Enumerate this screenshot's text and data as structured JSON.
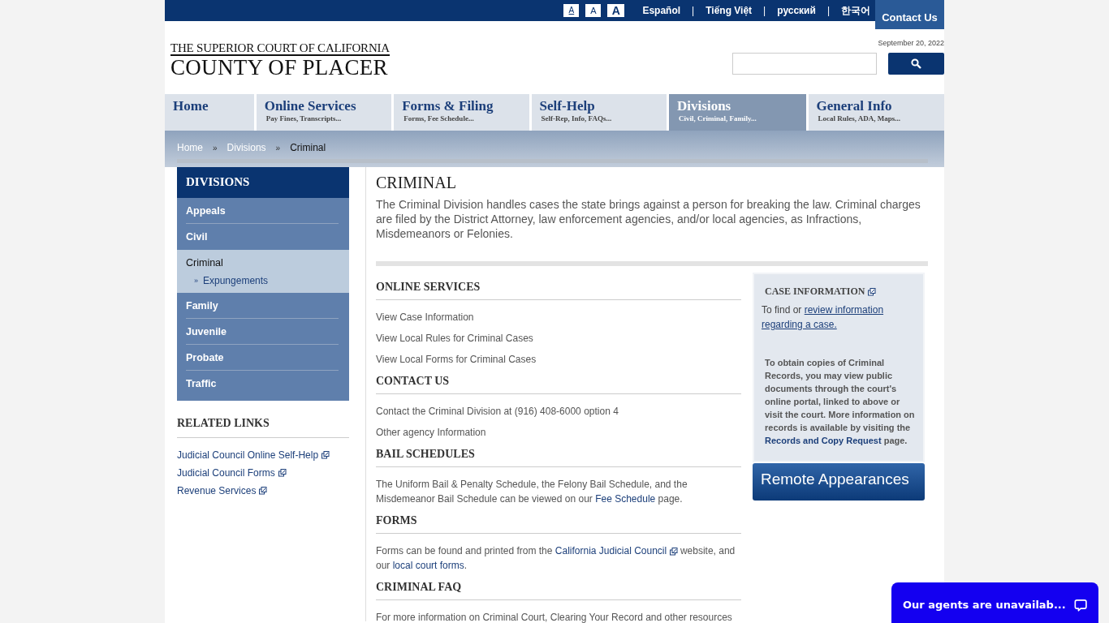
{
  "top_bar": {
    "font_sizes": [
      {
        "label": "A",
        "selected": true
      },
      {
        "label": "A",
        "selected": false
      },
      {
        "label": "A",
        "selected": false
      }
    ],
    "languages": [
      "Español",
      "Tiếng Việt",
      "русский",
      "한국어"
    ],
    "separator": "|",
    "contact": "Contact Us"
  },
  "header": {
    "logo_top": "THE SUPERIOR COURT OF CALIFORNIA",
    "logo_bottom": "COUNTY OF PLACER",
    "date": "September 20, 2022"
  },
  "nav": [
    {
      "title": "Home",
      "selected": false
    },
    {
      "title": "Online Services",
      "subtitle": "Pay Fines, Transcripts...",
      "selected": false
    },
    {
      "title": "Forms & Filing",
      "subtitle": "Forms, Fee Schedule...",
      "selected": false
    },
    {
      "title": "Self-Help",
      "subtitle": "Self-Rep, Info, FAQs...",
      "selected": false
    },
    {
      "title": "Divisions",
      "subtitle": "Civil, Criminal, Family...",
      "selected": true
    },
    {
      "title": "General Info",
      "subtitle": "Local Rules, ADA, Maps...",
      "selected": false
    }
  ],
  "breadcrumb": {
    "separator": "»",
    "items": [
      "Home",
      "Divisions",
      "Criminal"
    ]
  },
  "sidebar": {
    "heading": "DIVISIONS",
    "items": [
      {
        "label": "Appeals",
        "selected": false
      },
      {
        "label": "Civil",
        "selected": false
      },
      {
        "label": "Criminal",
        "selected": true,
        "children": [
          {
            "marker": "»",
            "label": "Expungements"
          }
        ]
      },
      {
        "label": "Family",
        "selected": false
      },
      {
        "label": "Juvenile",
        "selected": false
      },
      {
        "label": "Probate",
        "selected": false
      },
      {
        "label": "Traffic",
        "selected": false
      }
    ]
  },
  "related_links": {
    "heading": "RELATED LINKS",
    "links": [
      "Judicial Council Online Self-Help",
      "Judicial Council Forms",
      "Revenue Services"
    ]
  },
  "main": {
    "title": "CRIMINAL",
    "intro": "The Criminal Division handles cases the state brings against a person for breaking the law. Criminal charges are filed by the District Attorney, law enforcement agencies, and/or local agencies, as Infractions, Misdemeanors or Felonies.",
    "sections": [
      {
        "heading": "ONLINE SERVICES",
        "paragraphs": [
          [
            {
              "kind": "link",
              "text": "View Case Information"
            }
          ],
          [
            {
              "kind": "link",
              "text": "View Local Rules for Criminal Cases"
            }
          ],
          [
            {
              "kind": "link",
              "text": "View Local Forms for Criminal Cases"
            }
          ]
        ]
      },
      {
        "heading": "CONTACT US",
        "paragraphs": [
          [
            {
              "kind": "text",
              "text": "Contact the Criminal Division at (916) 408-6000 option 4"
            }
          ],
          [
            {
              "kind": "link",
              "text": "Other agency Information"
            }
          ]
        ]
      },
      {
        "heading": "BAIL SCHEDULES",
        "paragraphs": [
          [
            {
              "kind": "text",
              "text": "The Uniform Bail & Penalty Schedule, the Felony Bail Schedule, and the Misdemeanor Bail Schedule can be viewed on our "
            },
            {
              "kind": "link",
              "text": "Fee Schedule"
            },
            {
              "kind": "text",
              "text": " page."
            }
          ]
        ]
      },
      {
        "heading": "FORMS",
        "paragraphs": [
          [
            {
              "kind": "text",
              "text": "Forms can be found and printed from the "
            },
            {
              "kind": "external",
              "text": "California Judicial Council"
            },
            {
              "kind": "text",
              "text": " website, and our "
            },
            {
              "kind": "link",
              "text": "local court forms"
            },
            {
              "kind": "text",
              "text": "."
            }
          ]
        ]
      },
      {
        "heading": "CRIMINAL FAQ",
        "paragraphs": [
          [
            {
              "kind": "text",
              "text": "For more information on Criminal Court, Clearing Your Record and other resources"
            }
          ]
        ]
      }
    ]
  },
  "case_box": {
    "heading": "CASE INFORMATION",
    "lead": "To find or ",
    "lead_links": [
      "review information",
      "regarding a case."
    ],
    "note": [
      {
        "kind": "text",
        "text": "To obtain copies of Criminal Records, you may view public documents through the court's online portal, linked to above or visit the court. More information on records is available by visiting the "
      },
      {
        "kind": "link",
        "text": "Records and Copy Request"
      },
      {
        "kind": "text",
        "text": " page."
      }
    ]
  },
  "remote_button": "Remote Appearances",
  "chat": {
    "label": "Our agents are unavailab..."
  }
}
